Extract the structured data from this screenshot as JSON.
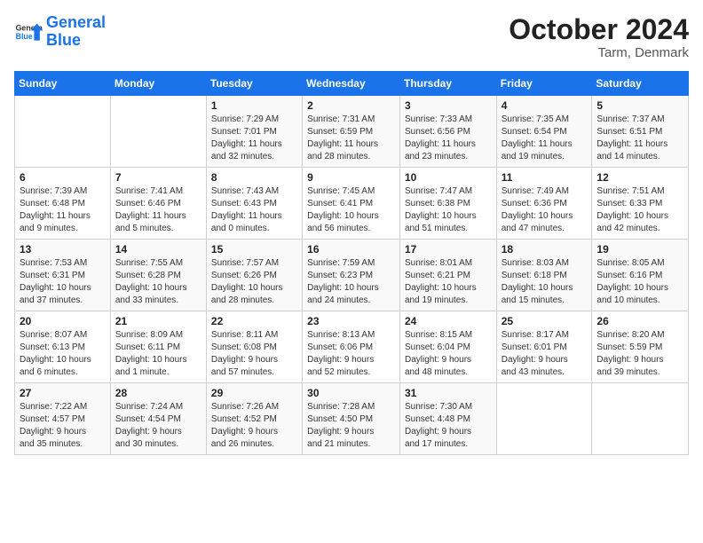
{
  "header": {
    "logo_line1": "General",
    "logo_line2": "Blue",
    "month": "October 2024",
    "location": "Tarm, Denmark"
  },
  "columns": [
    "Sunday",
    "Monday",
    "Tuesday",
    "Wednesday",
    "Thursday",
    "Friday",
    "Saturday"
  ],
  "weeks": [
    [
      {
        "day": "",
        "info": ""
      },
      {
        "day": "",
        "info": ""
      },
      {
        "day": "1",
        "info": "Sunrise: 7:29 AM\nSunset: 7:01 PM\nDaylight: 11 hours\nand 32 minutes."
      },
      {
        "day": "2",
        "info": "Sunrise: 7:31 AM\nSunset: 6:59 PM\nDaylight: 11 hours\nand 28 minutes."
      },
      {
        "day": "3",
        "info": "Sunrise: 7:33 AM\nSunset: 6:56 PM\nDaylight: 11 hours\nand 23 minutes."
      },
      {
        "day": "4",
        "info": "Sunrise: 7:35 AM\nSunset: 6:54 PM\nDaylight: 11 hours\nand 19 minutes."
      },
      {
        "day": "5",
        "info": "Sunrise: 7:37 AM\nSunset: 6:51 PM\nDaylight: 11 hours\nand 14 minutes."
      }
    ],
    [
      {
        "day": "6",
        "info": "Sunrise: 7:39 AM\nSunset: 6:48 PM\nDaylight: 11 hours\nand 9 minutes."
      },
      {
        "day": "7",
        "info": "Sunrise: 7:41 AM\nSunset: 6:46 PM\nDaylight: 11 hours\nand 5 minutes."
      },
      {
        "day": "8",
        "info": "Sunrise: 7:43 AM\nSunset: 6:43 PM\nDaylight: 11 hours\nand 0 minutes."
      },
      {
        "day": "9",
        "info": "Sunrise: 7:45 AM\nSunset: 6:41 PM\nDaylight: 10 hours\nand 56 minutes."
      },
      {
        "day": "10",
        "info": "Sunrise: 7:47 AM\nSunset: 6:38 PM\nDaylight: 10 hours\nand 51 minutes."
      },
      {
        "day": "11",
        "info": "Sunrise: 7:49 AM\nSunset: 6:36 PM\nDaylight: 10 hours\nand 47 minutes."
      },
      {
        "day": "12",
        "info": "Sunrise: 7:51 AM\nSunset: 6:33 PM\nDaylight: 10 hours\nand 42 minutes."
      }
    ],
    [
      {
        "day": "13",
        "info": "Sunrise: 7:53 AM\nSunset: 6:31 PM\nDaylight: 10 hours\nand 37 minutes."
      },
      {
        "day": "14",
        "info": "Sunrise: 7:55 AM\nSunset: 6:28 PM\nDaylight: 10 hours\nand 33 minutes."
      },
      {
        "day": "15",
        "info": "Sunrise: 7:57 AM\nSunset: 6:26 PM\nDaylight: 10 hours\nand 28 minutes."
      },
      {
        "day": "16",
        "info": "Sunrise: 7:59 AM\nSunset: 6:23 PM\nDaylight: 10 hours\nand 24 minutes."
      },
      {
        "day": "17",
        "info": "Sunrise: 8:01 AM\nSunset: 6:21 PM\nDaylight: 10 hours\nand 19 minutes."
      },
      {
        "day": "18",
        "info": "Sunrise: 8:03 AM\nSunset: 6:18 PM\nDaylight: 10 hours\nand 15 minutes."
      },
      {
        "day": "19",
        "info": "Sunrise: 8:05 AM\nSunset: 6:16 PM\nDaylight: 10 hours\nand 10 minutes."
      }
    ],
    [
      {
        "day": "20",
        "info": "Sunrise: 8:07 AM\nSunset: 6:13 PM\nDaylight: 10 hours\nand 6 minutes."
      },
      {
        "day": "21",
        "info": "Sunrise: 8:09 AM\nSunset: 6:11 PM\nDaylight: 10 hours\nand 1 minute."
      },
      {
        "day": "22",
        "info": "Sunrise: 8:11 AM\nSunset: 6:08 PM\nDaylight: 9 hours\nand 57 minutes."
      },
      {
        "day": "23",
        "info": "Sunrise: 8:13 AM\nSunset: 6:06 PM\nDaylight: 9 hours\nand 52 minutes."
      },
      {
        "day": "24",
        "info": "Sunrise: 8:15 AM\nSunset: 6:04 PM\nDaylight: 9 hours\nand 48 minutes."
      },
      {
        "day": "25",
        "info": "Sunrise: 8:17 AM\nSunset: 6:01 PM\nDaylight: 9 hours\nand 43 minutes."
      },
      {
        "day": "26",
        "info": "Sunrise: 8:20 AM\nSunset: 5:59 PM\nDaylight: 9 hours\nand 39 minutes."
      }
    ],
    [
      {
        "day": "27",
        "info": "Sunrise: 7:22 AM\nSunset: 4:57 PM\nDaylight: 9 hours\nand 35 minutes."
      },
      {
        "day": "28",
        "info": "Sunrise: 7:24 AM\nSunset: 4:54 PM\nDaylight: 9 hours\nand 30 minutes."
      },
      {
        "day": "29",
        "info": "Sunrise: 7:26 AM\nSunset: 4:52 PM\nDaylight: 9 hours\nand 26 minutes."
      },
      {
        "day": "30",
        "info": "Sunrise: 7:28 AM\nSunset: 4:50 PM\nDaylight: 9 hours\nand 21 minutes."
      },
      {
        "day": "31",
        "info": "Sunrise: 7:30 AM\nSunset: 4:48 PM\nDaylight: 9 hours\nand 17 minutes."
      },
      {
        "day": "",
        "info": ""
      },
      {
        "day": "",
        "info": ""
      }
    ]
  ]
}
